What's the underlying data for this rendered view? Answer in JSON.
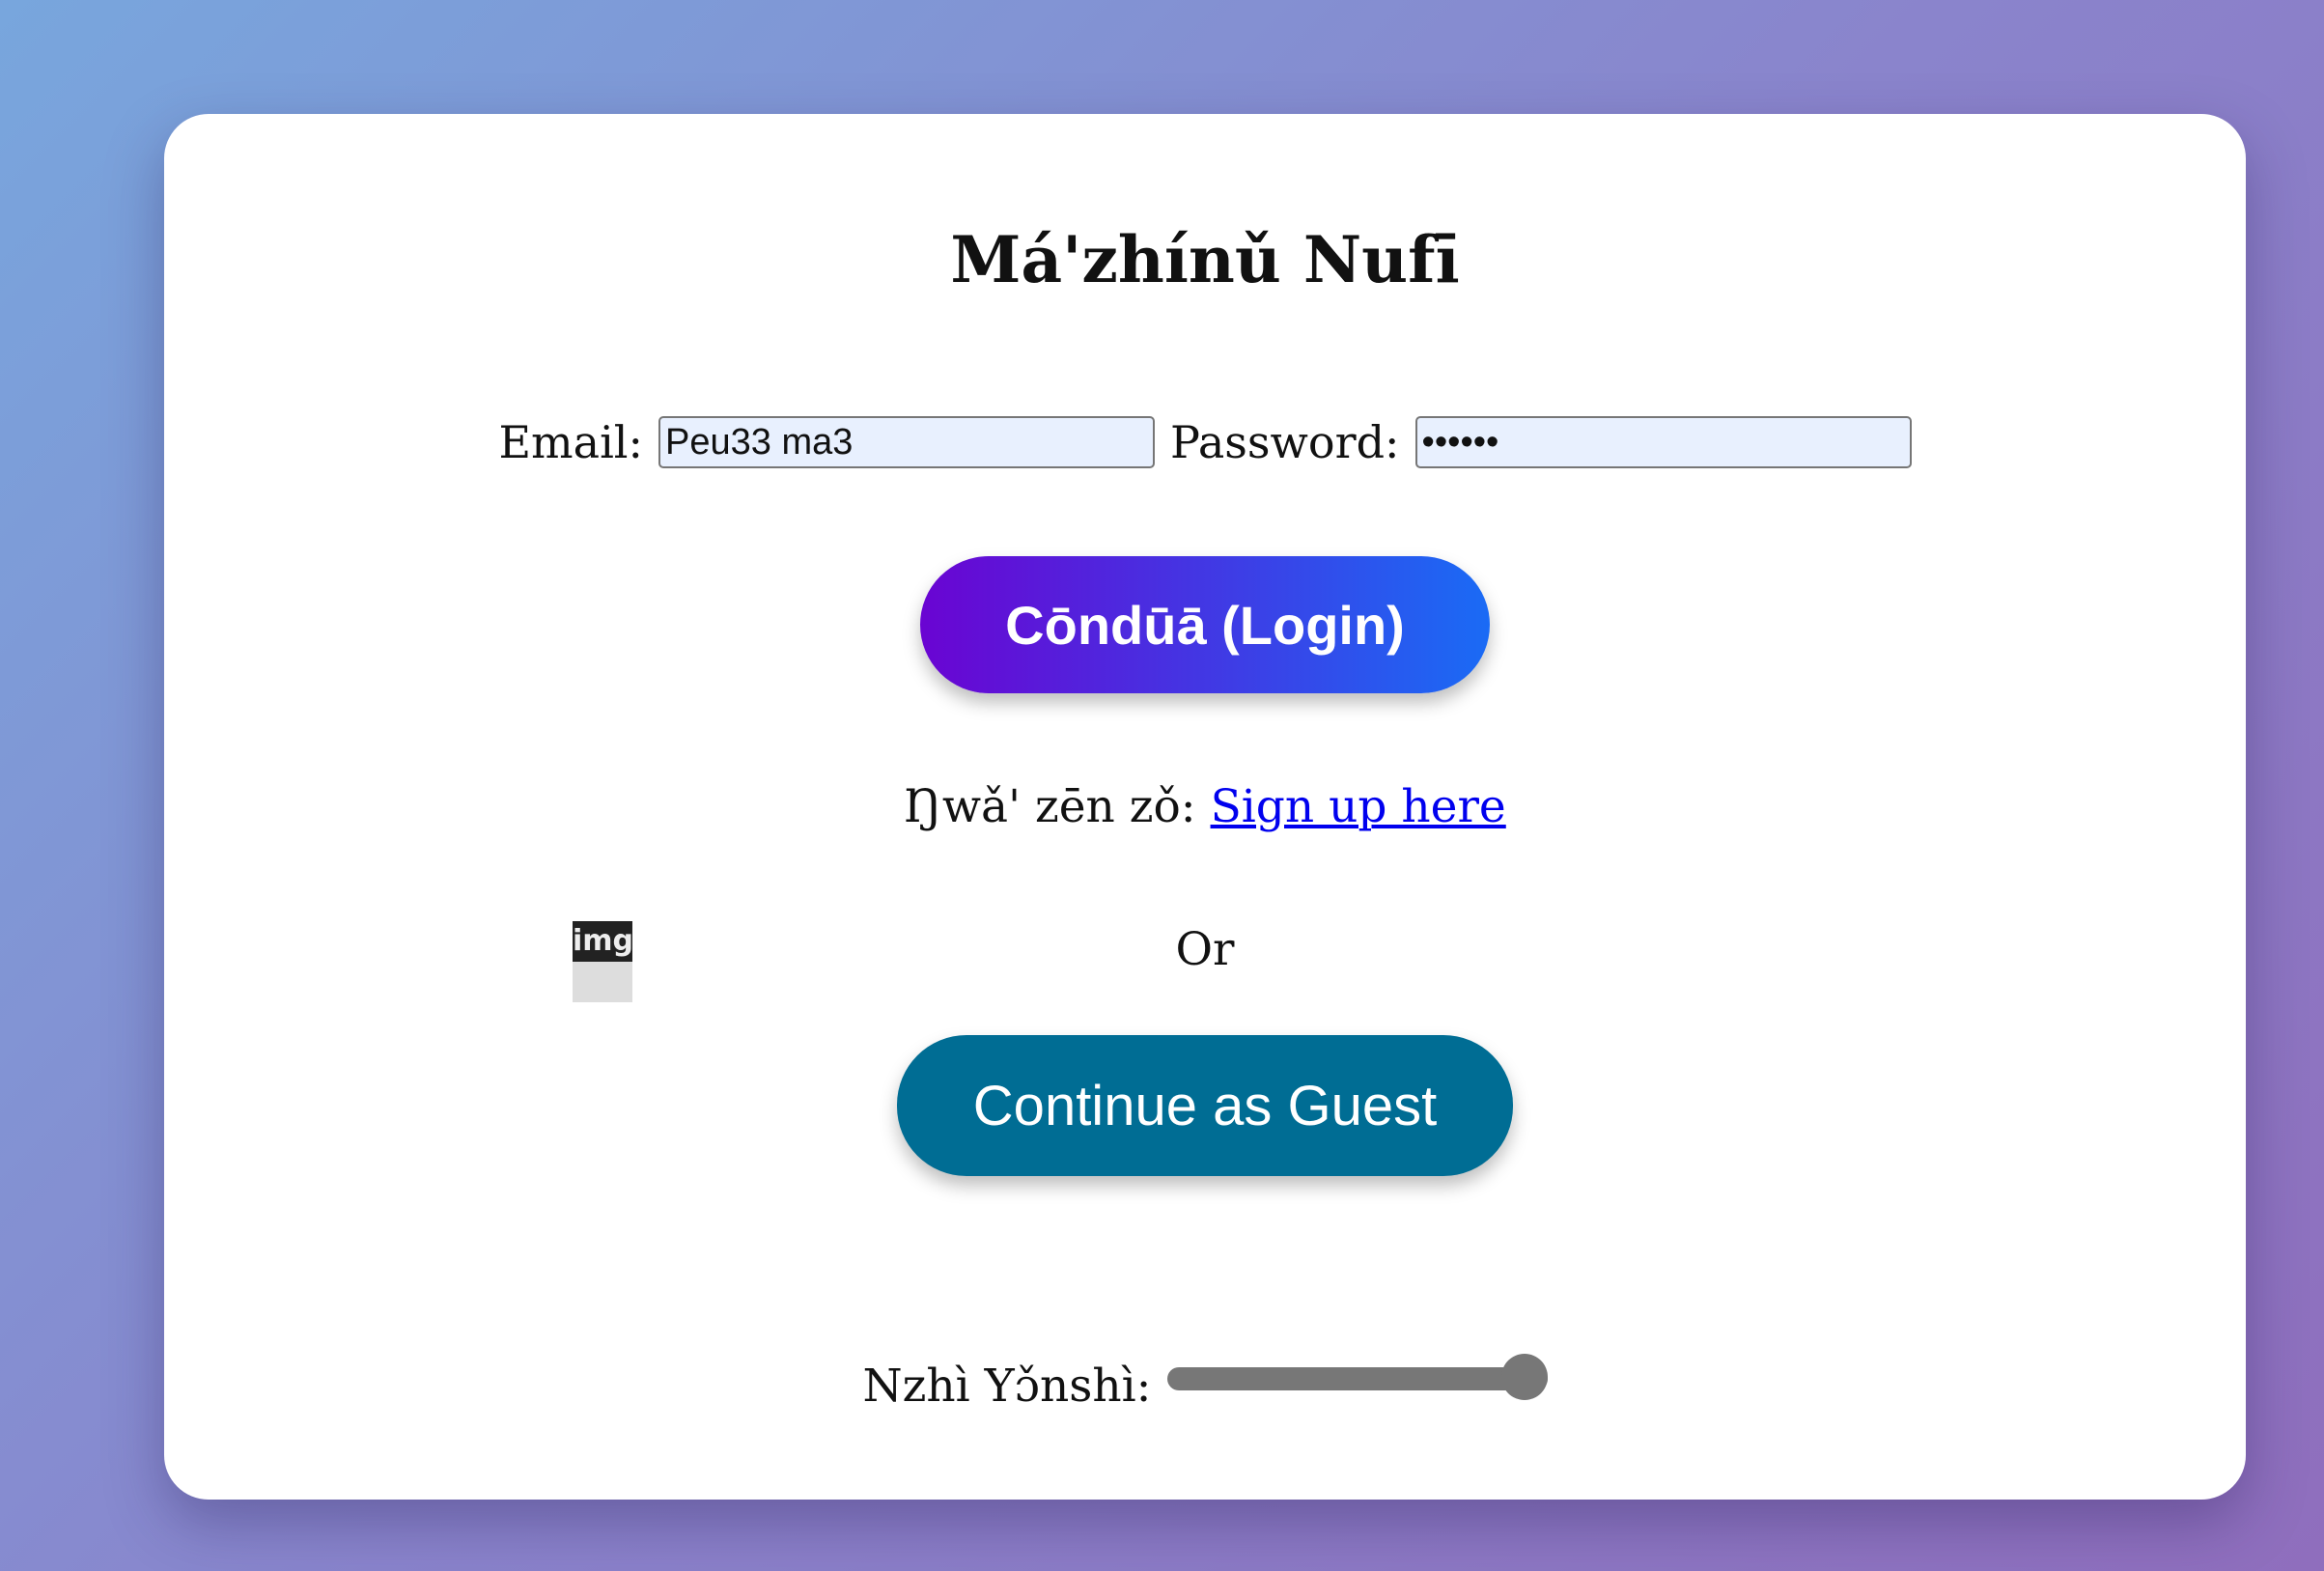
{
  "page": {
    "title": "Má'zhínǔ Nufī"
  },
  "login": {
    "email_label": "Email:",
    "email_value": "Peu33 ma3",
    "password_label": "Password:",
    "password_value": "••••••",
    "submit_label": "Cōndūā (Login)"
  },
  "signup": {
    "prompt": "Ŋwǎ' zēn zǒ: ",
    "link_text": "Sign up here"
  },
  "image": {
    "alt_text": "img"
  },
  "divider": {
    "text": "Or"
  },
  "guest": {
    "label": "Continue as Guest"
  },
  "volume": {
    "label": "Nzhì Yɔ̌nshì:",
    "value_percent": 94
  },
  "colors": {
    "login_gradient_start": "#6a04d2",
    "login_gradient_end": "#1a6bf5",
    "guest_button": "#006d94",
    "link": "#0000ee",
    "input_background": "#e8f0fe"
  }
}
